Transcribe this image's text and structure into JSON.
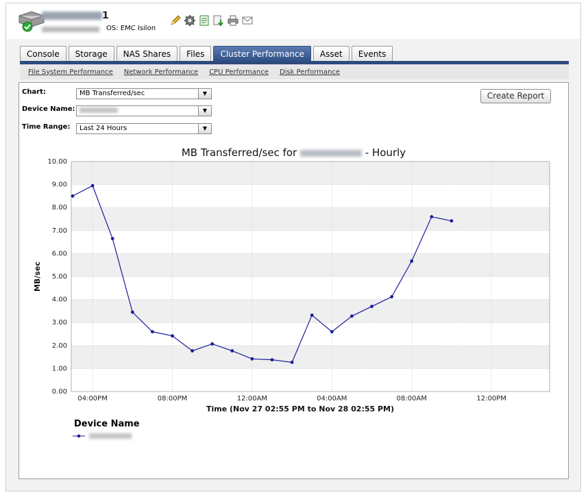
{
  "header": {
    "device_name": "",
    "os_label": "OS: EMC Isilon",
    "tools": [
      "pencil-icon",
      "gear-icon",
      "export-icon",
      "download-icon",
      "printer-icon",
      "email-icon"
    ]
  },
  "tabs": [
    {
      "label": "Console",
      "active": false
    },
    {
      "label": "Storage",
      "active": false
    },
    {
      "label": "NAS Shares",
      "active": false
    },
    {
      "label": "Files",
      "active": false
    },
    {
      "label": "Cluster Performance",
      "active": true
    },
    {
      "label": "Asset",
      "active": false
    },
    {
      "label": "Events",
      "active": false
    }
  ],
  "subnav": [
    "File System Performance",
    "Network Performance",
    "CPU Performance",
    "Disk Performance"
  ],
  "form": {
    "chart_label": "Chart:",
    "chart_value": "MB Transferred/sec",
    "device_label": "Device Name:",
    "device_value": "",
    "range_label": "Time Range:",
    "range_value": "Last 24 Hours",
    "create_report": "Create Report"
  },
  "chart_data": {
    "type": "line",
    "title_prefix": "MB Transferred/sec for",
    "title_suffix": "- Hourly",
    "ylabel": "MB/sec",
    "xlabel": "Time (Nov 27 02:55 PM to Nov 28 02:55 PM)",
    "ylim": [
      0,
      10
    ],
    "yticks": [
      "0.00",
      "1.00",
      "2.00",
      "3.00",
      "4.00",
      "5.00",
      "6.00",
      "7.00",
      "8.00",
      "9.00",
      "10.00"
    ],
    "xlim": [
      0,
      24
    ],
    "xticks": [
      {
        "x": 1,
        "label": "04:00PM"
      },
      {
        "x": 5,
        "label": "08:00PM"
      },
      {
        "x": 9,
        "label": "12:00AM"
      },
      {
        "x": 13,
        "label": "04:00AM"
      },
      {
        "x": 17,
        "label": "08:00AM"
      },
      {
        "x": 21,
        "label": "12:00PM"
      }
    ],
    "grid": true,
    "series": [
      {
        "x": [
          0,
          1,
          2,
          3,
          4,
          5,
          6,
          7,
          8,
          9,
          10,
          11,
          12,
          13,
          14,
          15,
          16,
          17,
          18,
          19
        ],
        "values": [
          8.5,
          8.95,
          6.65,
          3.45,
          2.6,
          2.42,
          1.77,
          2.07,
          1.77,
          1.42,
          1.38,
          1.27,
          3.32,
          2.6,
          3.28,
          3.7,
          4.12,
          5.67,
          7.6,
          7.42
        ],
        "color": "#1a1a9a"
      }
    ],
    "legend_title": "Device Name"
  }
}
